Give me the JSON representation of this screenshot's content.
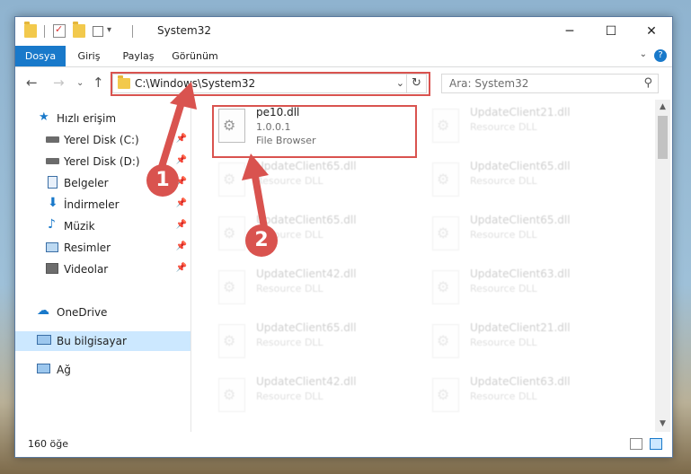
{
  "window": {
    "title": "System32"
  },
  "ribbon": {
    "tabs": [
      "Dosya",
      "Giriş",
      "Paylaş",
      "Görünüm"
    ],
    "help_label": "?"
  },
  "address": {
    "path": "C:\\Windows\\System32"
  },
  "search": {
    "placeholder": "Ara: System32"
  },
  "sidebar": {
    "items": [
      {
        "label": "Hızlı erişim"
      },
      {
        "label": "Yerel Disk (C:)"
      },
      {
        "label": "Yerel Disk (D:)"
      },
      {
        "label": "Belgeler"
      },
      {
        "label": "İndirmeler"
      },
      {
        "label": "Müzik"
      },
      {
        "label": "Resimler"
      },
      {
        "label": "Videolar"
      },
      {
        "label": "OneDrive"
      },
      {
        "label": "Bu bilgisayar"
      },
      {
        "label": "Ağ"
      }
    ]
  },
  "files": {
    "primary": {
      "name": "pe10.dll",
      "version": "1.0.0.1",
      "type": "File Browser"
    },
    "ghost": [
      {
        "name": "UpdateClient21.dll",
        "type": "Resource DLL"
      },
      {
        "name": "UpdateClient65.dll",
        "type": "Resource DLL"
      },
      {
        "name": "UpdateClient65.dll",
        "type": "Resource DLL"
      },
      {
        "name": "UpdateClient65.dll",
        "type": "Resource DLL"
      },
      {
        "name": "UpdateClient65.dll",
        "type": "Resource DLL"
      },
      {
        "name": "UpdateClient42.dll",
        "type": "Resource DLL"
      },
      {
        "name": "UpdateClient63.dll",
        "type": "Resource DLL"
      },
      {
        "name": "UpdateClient65.dll",
        "type": "Resource DLL"
      },
      {
        "name": "UpdateClient21.dll",
        "type": "Resource DLL"
      },
      {
        "name": "UpdateClient42.dll",
        "type": "Resource DLL"
      },
      {
        "name": "UpdateClient63.dll",
        "type": "Resource DLL"
      }
    ]
  },
  "status": {
    "count": "160 öğe"
  },
  "callouts": [
    "1",
    "2"
  ],
  "colors": {
    "accent": "#1979ca",
    "annotation": "#d9534f",
    "selection": "#cce8ff"
  }
}
